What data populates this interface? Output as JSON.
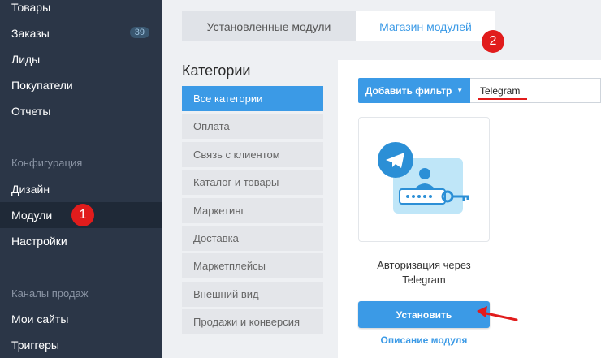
{
  "sidebar": {
    "items": [
      {
        "label": "Товары"
      },
      {
        "label": "Заказы",
        "badge": "39"
      },
      {
        "label": "Лиды"
      },
      {
        "label": "Покупатели"
      },
      {
        "label": "Отчеты"
      }
    ],
    "config_section": "Конфигурация",
    "config_items": [
      {
        "label": "Дизайн"
      },
      {
        "label": "Модули"
      },
      {
        "label": "Настройки"
      }
    ],
    "channels_section": "Каналы продаж",
    "channels_items": [
      {
        "label": "Мои сайты"
      },
      {
        "label": "Триггеры"
      }
    ]
  },
  "markers": {
    "one": "1",
    "two": "2"
  },
  "tabs": {
    "installed": "Установленные модули",
    "store": "Магазин модулей"
  },
  "categories": {
    "title": "Категории",
    "items": [
      "Все категории",
      "Оплата",
      "Связь с клиентом",
      "Каталог и товары",
      "Маркетинг",
      "Доставка",
      "Маркетплейсы",
      "Внешний вид",
      "Продажи и конверсия"
    ]
  },
  "filter": {
    "button_label": "Добавить фильтр",
    "search_value": "Telegram"
  },
  "module": {
    "name_line1": "Авторизация через",
    "name_line2": "Telegram",
    "install_label": "Установить",
    "description_link": "Описание модуля"
  },
  "colors": {
    "accent": "#3b9ae6",
    "sidebar": "#2b3647",
    "marker": "#e11c1c"
  }
}
